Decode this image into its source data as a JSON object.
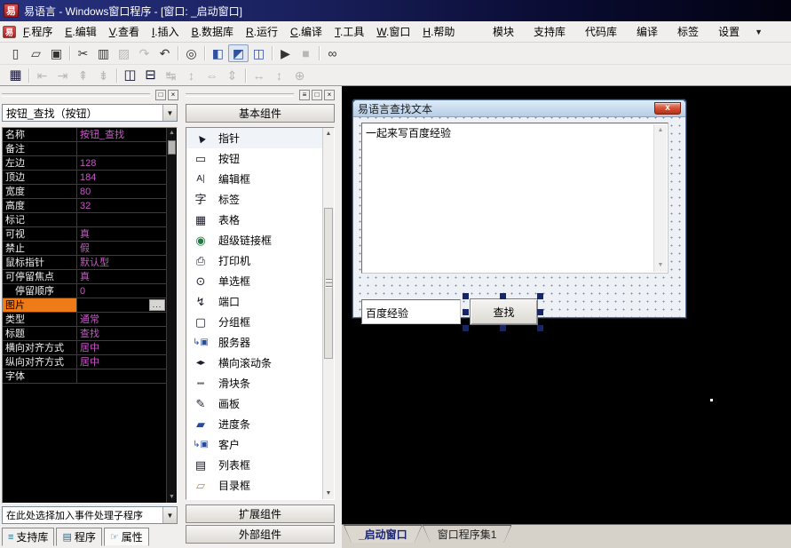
{
  "window": {
    "title": "易语言 - Windows窗口程序 - [窗口: _启动窗口]",
    "logo": "易"
  },
  "menubar": {
    "items": [
      {
        "key": "F",
        "rest": ".程序"
      },
      {
        "key": "E",
        "rest": ".编辑"
      },
      {
        "key": "V",
        "rest": ".查看"
      },
      {
        "key": "I",
        "rest": ".插入"
      },
      {
        "key": "B",
        "rest": ".数据库"
      },
      {
        "key": "R",
        "rest": ".运行"
      },
      {
        "key": "C",
        "rest": ".编译"
      },
      {
        "key": "T",
        "rest": ".工具"
      },
      {
        "key": "W",
        "rest": ".窗口"
      },
      {
        "key": "H",
        "rest": ".帮助"
      }
    ],
    "right_items": [
      "模块",
      "支持库",
      "代码库",
      "编译",
      "标签",
      "设置"
    ]
  },
  "icons": {
    "dropdown": "▼",
    "scroll_up": "▲",
    "scroll_down": "▼",
    "restore": "□",
    "close": "×",
    "panel_menu": "≡"
  },
  "toolbar_main": [
    {
      "name": "new-file-icon",
      "glyph": "▯"
    },
    {
      "name": "open-file-icon",
      "glyph": "▱"
    },
    {
      "name": "save-icon",
      "glyph": "▣"
    },
    {
      "separator": true
    },
    {
      "name": "cut-icon",
      "glyph": "✂"
    },
    {
      "name": "copy-icon",
      "glyph": "▥"
    },
    {
      "name": "paste-icon",
      "glyph": "▨",
      "disabled": true
    },
    {
      "name": "redo-icon",
      "glyph": "↷",
      "disabled": true
    },
    {
      "name": "undo-icon",
      "glyph": "↶"
    },
    {
      "separator": true
    },
    {
      "name": "find-text-icon",
      "glyph": "◎"
    },
    {
      "separator": true
    },
    {
      "name": "layout-left-panel-icon",
      "glyph": "◧",
      "blue": true
    },
    {
      "name": "layout-top-panel-icon",
      "glyph": "◩",
      "blue": true,
      "pressed": true
    },
    {
      "name": "layout-mixed-panel-icon",
      "glyph": "◫",
      "blue": true
    },
    {
      "separator": true
    },
    {
      "name": "run-icon",
      "glyph": "▶"
    },
    {
      "name": "stop-icon",
      "glyph": "■",
      "disabled": true
    },
    {
      "separator": true
    },
    {
      "name": "find-component-icon",
      "glyph": "∞"
    }
  ],
  "toolbar_layout": [
    {
      "name": "form-grid-icon",
      "glyph": "▦",
      "dark": true
    },
    {
      "separator": true
    },
    {
      "name": "align-left-icon",
      "glyph": "⇤",
      "disabled": true
    },
    {
      "name": "align-right-icon",
      "glyph": "⇥",
      "disabled": true
    },
    {
      "name": "align-top-icon",
      "glyph": "⇞",
      "disabled": true
    },
    {
      "name": "align-bottom-icon",
      "glyph": "⇟",
      "disabled": true
    },
    {
      "separator": true
    },
    {
      "name": "center-horizontal-icon",
      "glyph": "◫",
      "dark": true
    },
    {
      "name": "center-vertical-icon",
      "glyph": "⊟",
      "dark": true
    },
    {
      "name": "space-across-icon",
      "glyph": "↹",
      "disabled": true
    },
    {
      "name": "space-down-icon",
      "glyph": "↕",
      "disabled": true
    },
    {
      "name": "same-width-icon",
      "glyph": "⇔",
      "disabled": true
    },
    {
      "name": "same-height-icon",
      "glyph": "⇕",
      "disabled": true
    },
    {
      "separator": true
    },
    {
      "name": "stretch-width-icon",
      "glyph": "↔",
      "disabled": true
    },
    {
      "name": "stretch-height-icon",
      "glyph": "↕",
      "disabled": true
    },
    {
      "name": "stretch-both-icon",
      "glyph": "⊕",
      "disabled": true
    }
  ],
  "properties": {
    "selector": "按钮_查找（按钮）",
    "rows": [
      {
        "label": "名称",
        "value": "按钮_查找"
      },
      {
        "label": "备注",
        "value": ""
      },
      {
        "label": "左边",
        "value": "128"
      },
      {
        "label": "顶边",
        "value": "184"
      },
      {
        "label": "宽度",
        "value": "80"
      },
      {
        "label": "高度",
        "value": "32"
      },
      {
        "label": "标记",
        "value": ""
      },
      {
        "label": "可视",
        "value": "真"
      },
      {
        "label": "禁止",
        "value": "假"
      },
      {
        "label": "鼠标指针",
        "value": "默认型"
      },
      {
        "label": "可停留焦点",
        "value": "真"
      },
      {
        "label": "停留顺序",
        "value": "0",
        "indent": true
      },
      {
        "label": "图片",
        "value": "",
        "selected": true,
        "editor_button": "..."
      },
      {
        "label": "类型",
        "value": "通常"
      },
      {
        "label": "标题",
        "value": "查找"
      },
      {
        "label": "横向对齐方式",
        "value": "居中"
      },
      {
        "label": "纵向对齐方式",
        "value": "居中"
      },
      {
        "label": "字体",
        "value": ""
      }
    ],
    "event_selector": "在此处选择加入事件处理子程序",
    "tabs": [
      {
        "label": "支持库",
        "icon": "≡"
      },
      {
        "label": "程序",
        "icon": "▤"
      },
      {
        "label": "属性",
        "icon": "☞",
        "active": true
      }
    ]
  },
  "toolbox": {
    "header": "基本组件",
    "items": [
      {
        "name": "pointer-icon",
        "glyph": "▲",
        "label": "指针",
        "pointer": true,
        "selected": true
      },
      {
        "name": "button-icon",
        "glyph": "▭",
        "label": "按钮"
      },
      {
        "name": "editbox-icon",
        "glyph": "A|",
        "label": "编辑框",
        "small": true
      },
      {
        "name": "label-icon",
        "glyph": "字",
        "label": "标签"
      },
      {
        "name": "table-icon",
        "glyph": "▦",
        "label": "表格"
      },
      {
        "name": "hyperlink-icon",
        "glyph": "◉",
        "label": "超级链接框",
        "green": true
      },
      {
        "name": "printer-icon",
        "glyph": "⎙",
        "label": "打印机"
      },
      {
        "name": "radio-icon",
        "glyph": "⊙",
        "label": "单选框"
      },
      {
        "name": "port-icon",
        "glyph": "↯",
        "label": "端口"
      },
      {
        "name": "groupbox-icon",
        "glyph": "▢",
        "label": "分组框"
      },
      {
        "name": "server-icon",
        "glyph": "↳▣",
        "label": "服务器",
        "blue": true,
        "small": true
      },
      {
        "name": "hscrollbar-icon",
        "glyph": "◂▸",
        "label": "横向滚动条",
        "small": true
      },
      {
        "name": "slider-icon",
        "glyph": "┉",
        "label": "滑块条"
      },
      {
        "name": "canvas-icon",
        "glyph": "✎",
        "label": "画板"
      },
      {
        "name": "progressbar-icon",
        "glyph": "▰",
        "label": "进度条",
        "blue": true
      },
      {
        "name": "client-icon",
        "glyph": "↳▣",
        "label": "客户",
        "blue": true,
        "small": true
      },
      {
        "name": "listbox-icon",
        "glyph": "▤",
        "label": "列表框"
      },
      {
        "name": "dirbox-icon",
        "glyph": "▱",
        "label": "目录框",
        "yellow": true
      }
    ],
    "footers": [
      "扩展组件",
      "外部组件"
    ]
  },
  "designer": {
    "form": {
      "title": "易语言查找文本",
      "close": "x",
      "edit_text": "一起来写百度经验",
      "keyword_value": "百度经验",
      "find_label": "查找"
    },
    "tabs": [
      {
        "label": "_启动窗口",
        "active": true
      },
      {
        "label": "窗口程序集1"
      }
    ]
  },
  "colors": {
    "value_text": "#c659c6",
    "selected_row": "#ee7b17",
    "titlebar": "#1b2260",
    "form_background": "#edf1f6",
    "close_button": "#b23318",
    "active_tab_text": "#1a236e"
  }
}
